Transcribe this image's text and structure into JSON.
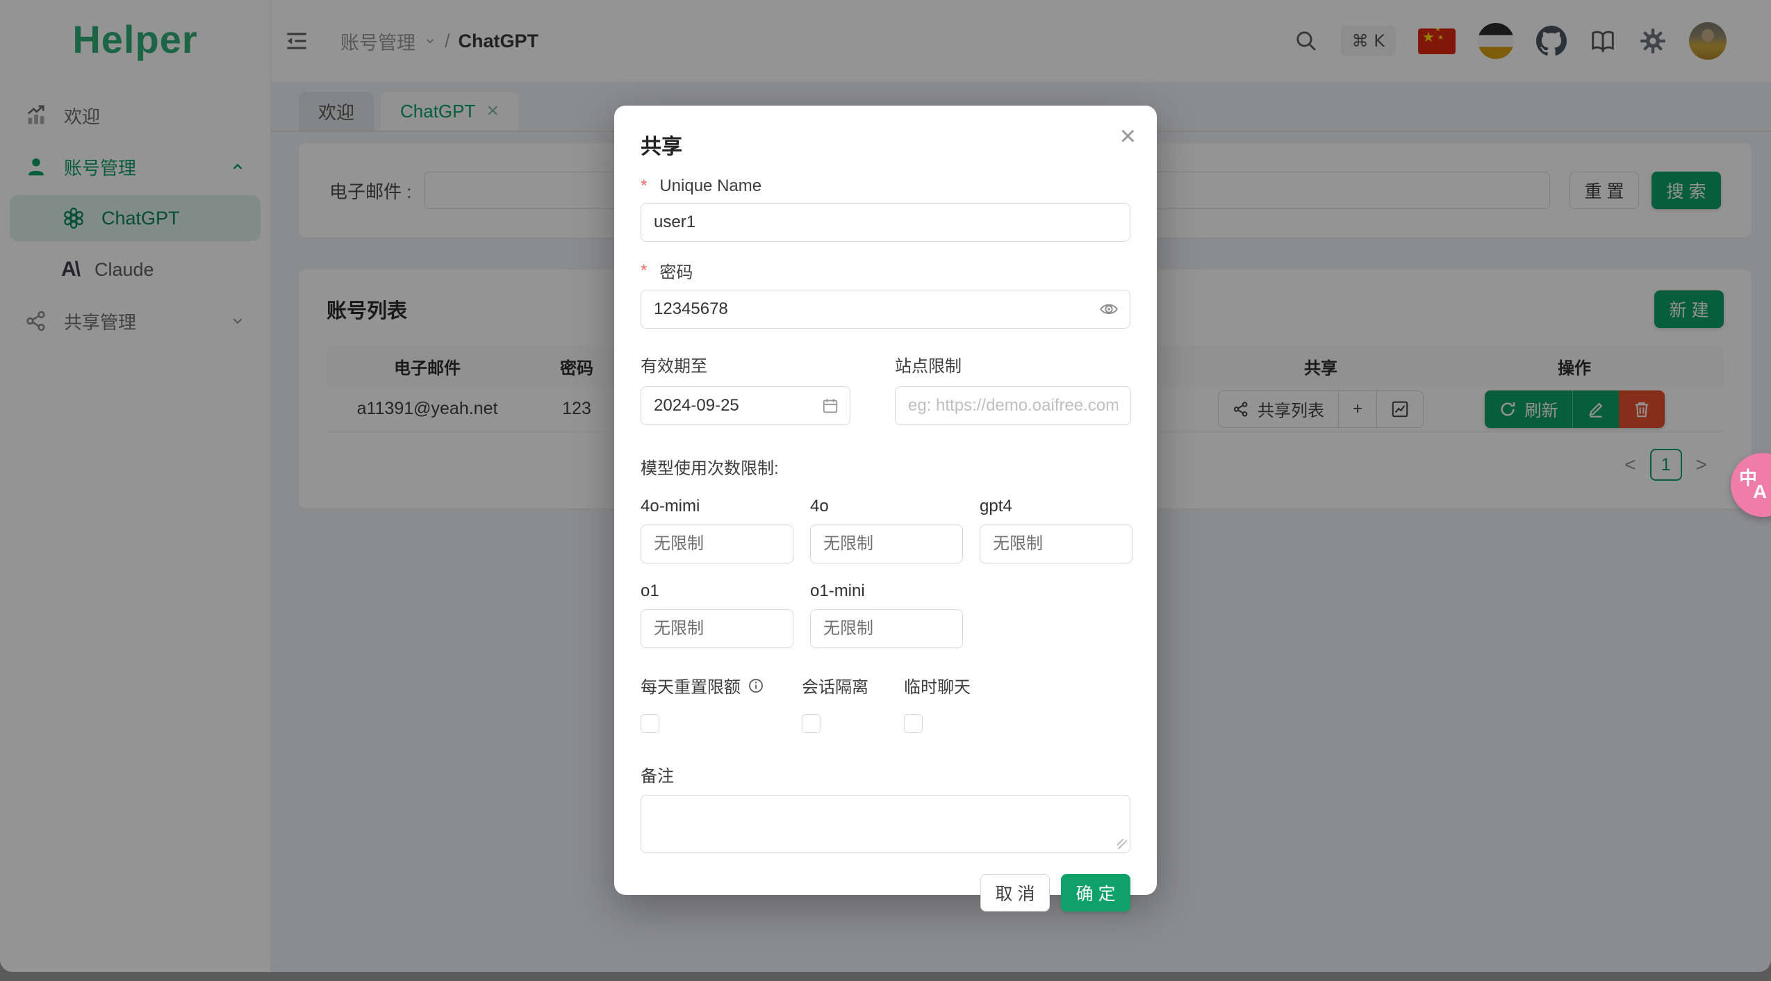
{
  "colors": {
    "primary": "#0ea168",
    "danger": "#e8502d",
    "brand_green": "#2fae76",
    "active_pill": "#dff0e8",
    "required": "#f56a5e",
    "translate_pink": "#f07ca8"
  },
  "brand": {
    "logo": "Helper"
  },
  "sidebar": {
    "items": [
      {
        "label": "欢迎"
      },
      {
        "label": "账号管理"
      },
      {
        "label": "ChatGPT"
      },
      {
        "label": "Claude"
      },
      {
        "label": "共享管理"
      }
    ]
  },
  "topbar": {
    "breadcrumb": {
      "menu": "账号管理",
      "separator": "/",
      "current": "ChatGPT"
    },
    "shortcut": "⌘ K"
  },
  "tabs": [
    {
      "label": "欢迎"
    },
    {
      "label": "ChatGPT",
      "close": "×"
    }
  ],
  "filter": {
    "email_label": "电子邮件 :",
    "reset_label": "重 置",
    "search_label": "搜 索"
  },
  "accounts": {
    "title": "账号列表",
    "new_label": "新 建",
    "table": {
      "headers": [
        "电子邮件",
        "密码",
        "",
        "共享",
        "操作"
      ]
    },
    "row": {
      "email": "a11391@yeah.net",
      "password": "123",
      "share_list_label": "共享列表",
      "plus": "+",
      "refresh_label": "刷新"
    },
    "pagination": {
      "prev": "<",
      "current": "1",
      "next": ">"
    }
  },
  "modal": {
    "title": "共享",
    "close": "×",
    "unique_name": {
      "label": "Unique Name",
      "value": "user1"
    },
    "password": {
      "label": "密码",
      "value": "12345678"
    },
    "valid_until": {
      "label": "有效期至",
      "value": "2024-09-25"
    },
    "site_limit": {
      "label": "站点限制",
      "placeholder": "eg: https://demo.oaifree.com"
    },
    "models_title": "模型使用次数限制:",
    "models": [
      {
        "label": "4o-mimi",
        "placeholder": "无限制"
      },
      {
        "label": "4o",
        "placeholder": "无限制"
      },
      {
        "label": "gpt4",
        "placeholder": "无限制"
      },
      {
        "label": "o1",
        "placeholder": "无限制"
      },
      {
        "label": "o1-mini",
        "placeholder": "无限制"
      }
    ],
    "checkboxes": [
      {
        "label": "每天重置限额"
      },
      {
        "label": "会话隔离"
      },
      {
        "label": "临时聊天"
      }
    ],
    "remark_label": "备注",
    "cancel_label": "取 消",
    "ok_label": "确 定"
  },
  "misc": {
    "anthropic_mark": "A\\",
    "flag_star": "★",
    "translate_zh": "中",
    "translate_a": "A"
  }
}
